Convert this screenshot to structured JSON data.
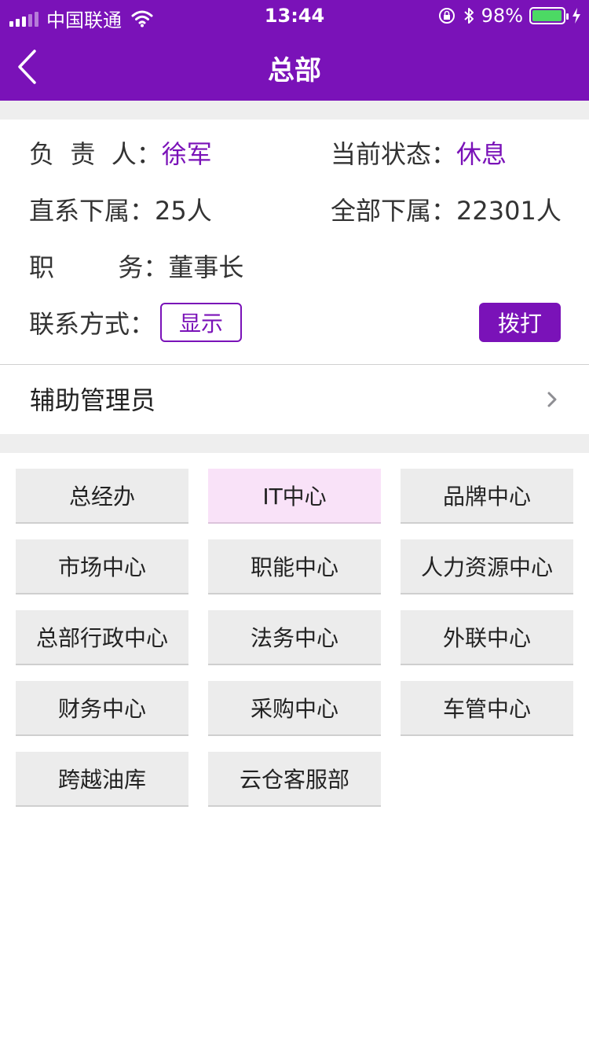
{
  "status_bar": {
    "carrier": "中国联通",
    "time": "13:44",
    "battery_percent": "98%",
    "battery_level": 0.98,
    "battery_color": "#4cd964"
  },
  "nav": {
    "title": "总部",
    "back_icon": "chevron-left-icon"
  },
  "colors": {
    "accent": "#7a12b8",
    "button_bg": "#ececec",
    "active_bg": "#f9e2f8"
  },
  "info": {
    "leader_label": "负  责  人：",
    "leader_value": "徐军",
    "state_label": "当前状态：",
    "state_value": "休息",
    "direct_label": "直系下属：",
    "direct_value": "25人",
    "all_label": "全部下属：",
    "all_value": "22301人",
    "position_label": "职        务：",
    "position_value": "董事长",
    "contact_label": "联系方式：",
    "show_button": "显示",
    "call_button": "拨打"
  },
  "admin": {
    "label": "辅助管理员"
  },
  "departments": [
    {
      "label": "总经办",
      "active": false
    },
    {
      "label": "IT中心",
      "active": true
    },
    {
      "label": "品牌中心",
      "active": false
    },
    {
      "label": "市场中心",
      "active": false
    },
    {
      "label": "职能中心",
      "active": false
    },
    {
      "label": "人力资源中心",
      "active": false
    },
    {
      "label": "总部行政中心",
      "active": false
    },
    {
      "label": "法务中心",
      "active": false
    },
    {
      "label": "外联中心",
      "active": false
    },
    {
      "label": "财务中心",
      "active": false
    },
    {
      "label": "采购中心",
      "active": false
    },
    {
      "label": "车管中心",
      "active": false
    },
    {
      "label": "跨越油库",
      "active": false
    },
    {
      "label": "云仓客服部",
      "active": false
    }
  ]
}
